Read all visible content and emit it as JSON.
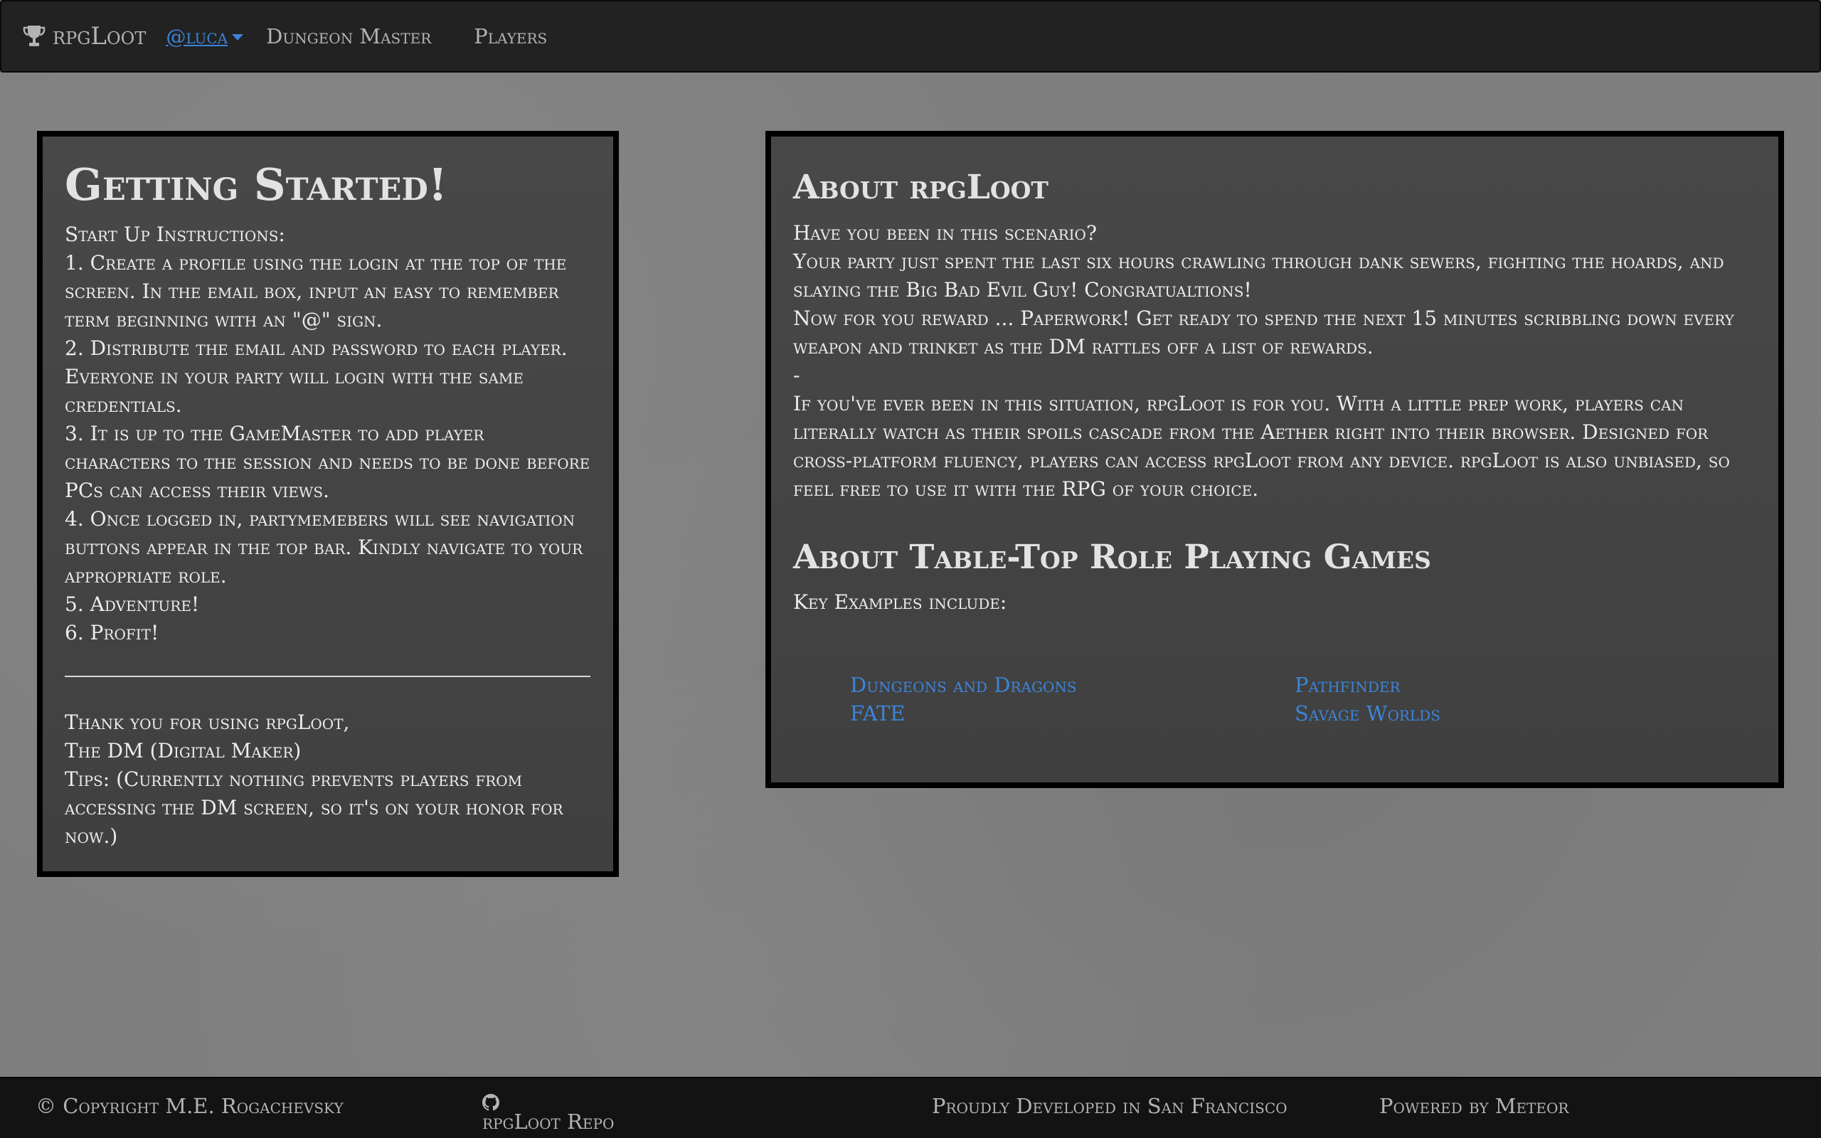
{
  "navbar": {
    "brand": "rpgLoot",
    "user": "@luca",
    "links": [
      "Dungeon Master",
      "Players"
    ]
  },
  "getting_started": {
    "title": "Getting Started!",
    "lines": [
      "Start Up Instructions:",
      "1. Create a profile using the login at the top of the screen. In the email box, input an easy to remember term beginning with an \"@\" sign.",
      "2. Distribute the email and password to each player. Everyone in your party will login with the same credentials.",
      "3. It is up to the GameMaster to add player characters to the session and needs to be done before PCs can access their views.",
      "4. Once logged in, partymemebers will see navigation buttons appear in the top bar. Kindly navigate to your appropriate role.",
      "5. Adventure!",
      "6. Profit!"
    ],
    "closing": [
      "Thank you for using rpgLoot,",
      "The DM (Digital Maker)",
      "Tips: (Currently nothing prevents players from accessing the DM screen, so it's on your honor for now.)"
    ]
  },
  "about": {
    "title": "About rpgLoot",
    "lines": [
      "Have you been in this scenario?",
      "Your party just spent the last six hours crawling through dank sewers, fighting the hoards, and slaying the Big Bad Evil Guy! Congratualtions!",
      "Now for you reward ... Paperwork! Get ready to spend the next 15 minutes scribbling down every weapon and trinket as the DM rattles off a list of rewards.",
      "-",
      "If you've ever been in this situation, rpgLoot is for you. With a little prep work, players can literally watch as their spoils cascade from the Aether right into their browser. Designed for cross-platform fluency, players can access rpgLoot from any device. rpgLoot is also unbiased, so feel free to use it with the RPG of your choice."
    ]
  },
  "ttrpg": {
    "title": "About Table-Top Role Playing Games",
    "intro": "Key Examples include:",
    "games": [
      "Dungeons and Dragons",
      "Pathfinder",
      "FATE",
      "Savage Worlds"
    ]
  },
  "footer": {
    "copyright": "© Copyright M.E. Rogachevsky",
    "repo": "rpgLoot Repo",
    "location": "Proudly Developed in San Francisco",
    "powered": "Powered by Meteor"
  },
  "colors": {
    "link": "#3d84d8",
    "navbar": "#222222",
    "panel": "#424242",
    "background": "#7f7f7f"
  }
}
